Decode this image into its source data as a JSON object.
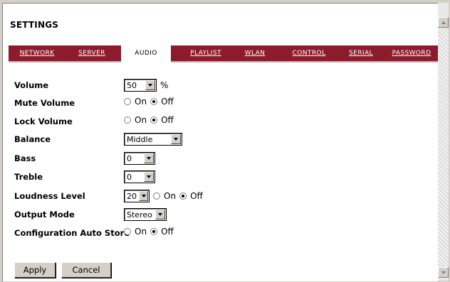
{
  "title": "SETTINGS",
  "tabs": [
    {
      "label": "NETWORK",
      "active": false
    },
    {
      "label": "SERVER",
      "active": false
    },
    {
      "label": "AUDIO",
      "active": true
    },
    {
      "label": "PLAYLIST",
      "active": false
    },
    {
      "label": "WLAN",
      "active": false
    },
    {
      "label": "CONTROL",
      "active": false
    },
    {
      "label": "SERIAL",
      "active": false
    },
    {
      "label": "PASSWORD",
      "active": false
    }
  ],
  "fields": {
    "volume": {
      "label": "Volume",
      "value": "50",
      "unit": "%"
    },
    "mute": {
      "label": "Mute Volume",
      "on": "On",
      "off": "Off",
      "selected": "Off"
    },
    "lock": {
      "label": "Lock Volume",
      "on": "On",
      "off": "Off",
      "selected": "Off"
    },
    "balance": {
      "label": "Balance",
      "value": "Middle"
    },
    "bass": {
      "label": "Bass",
      "value": "0"
    },
    "treble": {
      "label": "Treble",
      "value": "0"
    },
    "loudness": {
      "label": "Loudness Level",
      "value": "20",
      "on": "On",
      "off": "Off",
      "selected": "Off"
    },
    "output": {
      "label": "Output Mode",
      "value": "Stereo"
    },
    "autostore": {
      "label": "Configuration Auto Store",
      "on": "On",
      "off": "Off",
      "selected": "Off"
    }
  },
  "buttons": {
    "apply": "Apply",
    "cancel": "Cancel"
  },
  "colors": {
    "tabbar": "#8c1b2b"
  }
}
